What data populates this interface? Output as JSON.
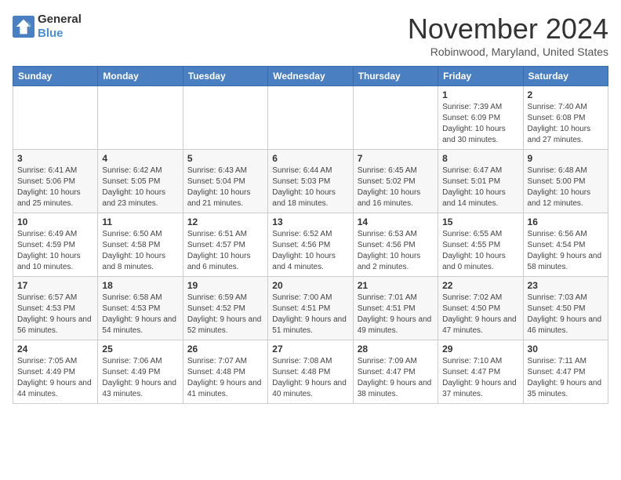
{
  "header": {
    "logo_line1": "General",
    "logo_line2": "Blue",
    "month_title": "November 2024",
    "location": "Robinwood, Maryland, United States"
  },
  "days_of_week": [
    "Sunday",
    "Monday",
    "Tuesday",
    "Wednesday",
    "Thursday",
    "Friday",
    "Saturday"
  ],
  "weeks": [
    [
      {
        "day": "",
        "info": ""
      },
      {
        "day": "",
        "info": ""
      },
      {
        "day": "",
        "info": ""
      },
      {
        "day": "",
        "info": ""
      },
      {
        "day": "",
        "info": ""
      },
      {
        "day": "1",
        "info": "Sunrise: 7:39 AM\nSunset: 6:09 PM\nDaylight: 10 hours and 30 minutes."
      },
      {
        "day": "2",
        "info": "Sunrise: 7:40 AM\nSunset: 6:08 PM\nDaylight: 10 hours and 27 minutes."
      }
    ],
    [
      {
        "day": "3",
        "info": "Sunrise: 6:41 AM\nSunset: 5:06 PM\nDaylight: 10 hours and 25 minutes."
      },
      {
        "day": "4",
        "info": "Sunrise: 6:42 AM\nSunset: 5:05 PM\nDaylight: 10 hours and 23 minutes."
      },
      {
        "day": "5",
        "info": "Sunrise: 6:43 AM\nSunset: 5:04 PM\nDaylight: 10 hours and 21 minutes."
      },
      {
        "day": "6",
        "info": "Sunrise: 6:44 AM\nSunset: 5:03 PM\nDaylight: 10 hours and 18 minutes."
      },
      {
        "day": "7",
        "info": "Sunrise: 6:45 AM\nSunset: 5:02 PM\nDaylight: 10 hours and 16 minutes."
      },
      {
        "day": "8",
        "info": "Sunrise: 6:47 AM\nSunset: 5:01 PM\nDaylight: 10 hours and 14 minutes."
      },
      {
        "day": "9",
        "info": "Sunrise: 6:48 AM\nSunset: 5:00 PM\nDaylight: 10 hours and 12 minutes."
      }
    ],
    [
      {
        "day": "10",
        "info": "Sunrise: 6:49 AM\nSunset: 4:59 PM\nDaylight: 10 hours and 10 minutes."
      },
      {
        "day": "11",
        "info": "Sunrise: 6:50 AM\nSunset: 4:58 PM\nDaylight: 10 hours and 8 minutes."
      },
      {
        "day": "12",
        "info": "Sunrise: 6:51 AM\nSunset: 4:57 PM\nDaylight: 10 hours and 6 minutes."
      },
      {
        "day": "13",
        "info": "Sunrise: 6:52 AM\nSunset: 4:56 PM\nDaylight: 10 hours and 4 minutes."
      },
      {
        "day": "14",
        "info": "Sunrise: 6:53 AM\nSunset: 4:56 PM\nDaylight: 10 hours and 2 minutes."
      },
      {
        "day": "15",
        "info": "Sunrise: 6:55 AM\nSunset: 4:55 PM\nDaylight: 10 hours and 0 minutes."
      },
      {
        "day": "16",
        "info": "Sunrise: 6:56 AM\nSunset: 4:54 PM\nDaylight: 9 hours and 58 minutes."
      }
    ],
    [
      {
        "day": "17",
        "info": "Sunrise: 6:57 AM\nSunset: 4:53 PM\nDaylight: 9 hours and 56 minutes."
      },
      {
        "day": "18",
        "info": "Sunrise: 6:58 AM\nSunset: 4:53 PM\nDaylight: 9 hours and 54 minutes."
      },
      {
        "day": "19",
        "info": "Sunrise: 6:59 AM\nSunset: 4:52 PM\nDaylight: 9 hours and 52 minutes."
      },
      {
        "day": "20",
        "info": "Sunrise: 7:00 AM\nSunset: 4:51 PM\nDaylight: 9 hours and 51 minutes."
      },
      {
        "day": "21",
        "info": "Sunrise: 7:01 AM\nSunset: 4:51 PM\nDaylight: 9 hours and 49 minutes."
      },
      {
        "day": "22",
        "info": "Sunrise: 7:02 AM\nSunset: 4:50 PM\nDaylight: 9 hours and 47 minutes."
      },
      {
        "day": "23",
        "info": "Sunrise: 7:03 AM\nSunset: 4:50 PM\nDaylight: 9 hours and 46 minutes."
      }
    ],
    [
      {
        "day": "24",
        "info": "Sunrise: 7:05 AM\nSunset: 4:49 PM\nDaylight: 9 hours and 44 minutes."
      },
      {
        "day": "25",
        "info": "Sunrise: 7:06 AM\nSunset: 4:49 PM\nDaylight: 9 hours and 43 minutes."
      },
      {
        "day": "26",
        "info": "Sunrise: 7:07 AM\nSunset: 4:48 PM\nDaylight: 9 hours and 41 minutes."
      },
      {
        "day": "27",
        "info": "Sunrise: 7:08 AM\nSunset: 4:48 PM\nDaylight: 9 hours and 40 minutes."
      },
      {
        "day": "28",
        "info": "Sunrise: 7:09 AM\nSunset: 4:47 PM\nDaylight: 9 hours and 38 minutes."
      },
      {
        "day": "29",
        "info": "Sunrise: 7:10 AM\nSunset: 4:47 PM\nDaylight: 9 hours and 37 minutes."
      },
      {
        "day": "30",
        "info": "Sunrise: 7:11 AM\nSunset: 4:47 PM\nDaylight: 9 hours and 35 minutes."
      }
    ]
  ]
}
